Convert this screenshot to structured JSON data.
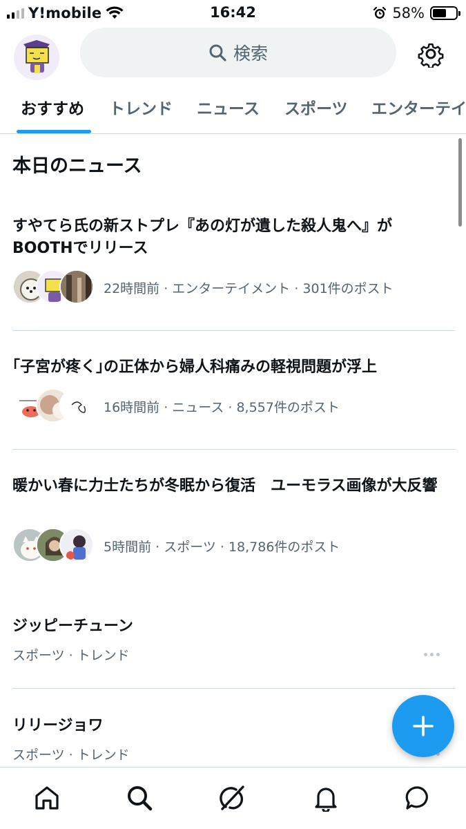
{
  "status_bar": {
    "carrier": "Y!mobile",
    "time": "16:42",
    "battery_percent": "58%",
    "battery_level": 0.58,
    "icons": [
      "signal-icon",
      "wifi-icon",
      "alarm-icon",
      "battery-icon"
    ]
  },
  "header": {
    "search_placeholder": "検索",
    "icons": [
      "profile-avatar",
      "search-icon",
      "gear-icon"
    ]
  },
  "tabs": [
    {
      "label": "おすすめ",
      "active": true
    },
    {
      "label": "トレンド",
      "active": false
    },
    {
      "label": "ニュース",
      "active": false
    },
    {
      "label": "スポーツ",
      "active": false
    },
    {
      "label": "エンターテイ",
      "active": false
    }
  ],
  "section_title": "本日のニュース",
  "news": [
    {
      "title": "すやてら氏の新ストプレ『あの灯が遺した殺人鬼へ』がBOOTHでリリース",
      "meta": "22時間前 · エンターテイメント · 301件のポスト"
    },
    {
      "title": "｢子宮が疼く｣の正体から婦人科痛みの軽視問題が浮上",
      "meta": "16時間前 · ニュース · 8,557件のポスト"
    },
    {
      "title": "暖かい春に力士たちが冬眠から復活　ユーモラス画像が大反響",
      "meta": "5時間前 · スポーツ · 18,786件のポスト"
    }
  ],
  "trends": [
    {
      "name": "ジッピーチューン",
      "category": "スポーツ · トレンド"
    },
    {
      "name": "リリージョワ",
      "category": "スポーツ · トレンド"
    }
  ],
  "fab": {
    "icon": "plus-icon"
  },
  "bottom_nav": [
    "home-icon",
    "search-icon",
    "grok-icon",
    "bell-icon",
    "message-icon"
  ],
  "colors": {
    "accent": "#1d9bf0",
    "text_primary": "#0f1419",
    "text_secondary": "#536471",
    "divider": "#cfd9de",
    "search_bg": "#eff3f4"
  }
}
